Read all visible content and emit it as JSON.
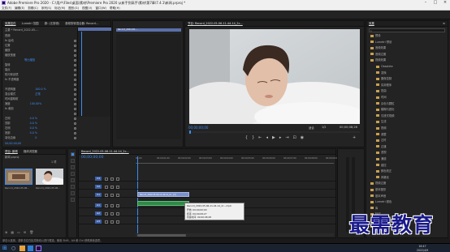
{
  "app": {
    "title": "Adobe Premiere Pro 2020 - C:\\用户\\Files\\桌面\\素材\\Premiere Pro 2020 从新手到高手\\素材\\第7章\\7.4.1\\新闻.prproj *",
    "menu": [
      "文件(F)",
      "编辑(E)",
      "剪辑(C)",
      "序列(S)",
      "标记(M)",
      "图形(G)",
      "视图(V)",
      "窗口(W)",
      "帮助(H)"
    ]
  },
  "effect_controls": {
    "tabs": [
      "效果控件",
      "Lumetri 范围",
      "源: (无剪辑)",
      "音频剪辑混合器: Record..."
    ],
    "source_label": "主要 * Record_2022-05-...",
    "clip_label": "Record_2022-05-...",
    "video_section": "视频",
    "rows": [
      {
        "label": "fx 运动"
      },
      {
        "label": "位置",
        "value": ""
      },
      {
        "label": "缩放",
        "value": ""
      },
      {
        "label": "缩放宽度",
        "value": ""
      },
      {
        "label": "",
        "value": "等比缩放"
      },
      {
        "label": "旋转",
        "value": ""
      },
      {
        "label": "锚点",
        "value": ""
      },
      {
        "label": "防闪烁滤镜",
        "value": ""
      },
      {
        "label": "fx 不透明度"
      },
      {
        "label": "",
        "value": ""
      },
      {
        "label": "不透明度",
        "value": "100.0 %"
      },
      {
        "label": "混合模式",
        "value": "正常"
      },
      {
        "label": "时间重映射"
      },
      {
        "label": "速度",
        "value": "100.00%"
      },
      {
        "label": "fx 裁剪"
      },
      {
        "label": "",
        "value": ""
      },
      {
        "label": "左侧",
        "value": "0.0 %"
      },
      {
        "label": "顶部",
        "value": "0.0 %"
      },
      {
        "label": "右侧",
        "value": "0.0 %"
      },
      {
        "label": "底部",
        "value": "0.0 %"
      },
      {
        "label": "羽化边缘",
        "value": "0"
      }
    ],
    "timecode": "00;00;00;00"
  },
  "program_monitor": {
    "title": "节目: Record_2022-05-06-11-44-14_2c...",
    "timecode_current": "00;00;00;00",
    "fit_label": "适合",
    "ratio_label": "1/2",
    "timecode_duration": "00;00;08;28"
  },
  "project": {
    "tabs": [
      "项目: 新闻",
      "媒体浏览器"
    ],
    "file": "新闻.prproj",
    "count": "1 项",
    "clips": [
      {
        "name": "Record_2022-05-06...",
        "duration": "8;28"
      },
      {
        "name": "Record_2022-05-06...",
        "duration": "8;28"
      }
    ]
  },
  "timeline": {
    "tab": "Record_2022-05-06-11-44-14_2c...",
    "timecode": "00;00;00;00",
    "ruler": [
      "00;00",
      "00;00;01;00",
      "00;00;02;00",
      "00;00;03;00",
      "00;00;04;00",
      "00;00;05;00",
      "00;00;06;00",
      "00;00;07;00",
      "00;00;08;00",
      "00;00;09;00"
    ],
    "tracks_video": [
      "V3",
      "V2",
      "V1"
    ],
    "tracks_audio": [
      "A1",
      "A2",
      "A3"
    ],
    "clip_label": "Record_2022-05-06-11-44-14_2c...[V]",
    "tooltip": {
      "title": "Record_2022-05-06-11-44-14_2c...mp4",
      "start": "开始: 00;00;00;00",
      "end": "结束: 00;00;08;27",
      "duration": "持续时间: 00;00;08;28"
    }
  },
  "effects_panel": {
    "title": "效果",
    "items": [
      "预设",
      "Lumetri 预设",
      "音频效果",
      "音频过渡",
      "视频效果",
      "Obsolete",
      "变换",
      "图像控制",
      "实用程序",
      "扭曲",
      "时间",
      "杂色与颗粒",
      "模糊与锐化",
      "沉浸式视频",
      "生成",
      "视频",
      "调整",
      "过时",
      "过渡",
      "透视",
      "通道",
      "键控",
      "颜色校正",
      "风格化",
      "视频过渡",
      "基本图形",
      "基本声音",
      "Lumetri 颜色",
      "库",
      "标记",
      "历史记录",
      "信息"
    ]
  },
  "status_text": "单击以选择，或单击空白处并拖动以进行框选。使用 Shift、Alt 和 Ctrl 获得其他选项。",
  "watermark": "最需教育",
  "taskbar": {
    "time": "16:47",
    "date": "2022/4/9"
  },
  "colors": {
    "accent_blue": "#3d8cf0",
    "clip_blue": "#6a86c8",
    "audio_green": "#2f8a47",
    "playhead": "#3d8cf0"
  }
}
